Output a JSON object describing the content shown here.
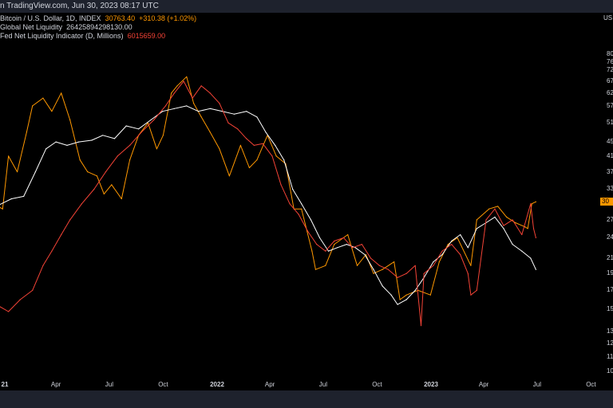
{
  "header": {
    "published": "n TradingView.com, Jun 30, 2023 08:17 UTC"
  },
  "legend": {
    "btc_name": "Bitcoin / U.S. Dollar, 1D, INDEX",
    "btc_value": "30763.40",
    "btc_change": "+310.38 (+1.02%)",
    "gnl_name": "Global Net Liquidity",
    "gnl_value": "26425894298130.00",
    "fed_name": "Fed Net Liquidity Indicator (D, Millions)",
    "fed_value": "6015659.00"
  },
  "price_axis": {
    "currency_label": "US",
    "badge": "30"
  },
  "colors": {
    "btc": "#ff9800",
    "global_net_liquidity": "#ffffff",
    "fed_net_liquidity": "#f44336",
    "background": "#000000",
    "panel": "#1e222d"
  },
  "chart_data": {
    "type": "line",
    "y_ticks": [
      "80",
      "76",
      "72",
      "67",
      "62",
      "57",
      "51",
      "45",
      "41",
      "37",
      "33",
      "30",
      "27",
      "24",
      "21",
      "19",
      "17",
      "15",
      "13",
      "12",
      "11",
      "10"
    ],
    "y_scale": "log",
    "x_ticks": [
      {
        "label": "21",
        "date": "2021-01-01",
        "bold": true
      },
      {
        "label": "Apr",
        "date": "2021-04-01",
        "bold": false
      },
      {
        "label": "Jul",
        "date": "2021-07-01",
        "bold": false
      },
      {
        "label": "Oct",
        "date": "2021-10-01",
        "bold": false
      },
      {
        "label": "2022",
        "date": "2022-01-01",
        "bold": true
      },
      {
        "label": "Apr",
        "date": "2022-04-01",
        "bold": false
      },
      {
        "label": "Jul",
        "date": "2022-07-01",
        "bold": false
      },
      {
        "label": "Oct",
        "date": "2022-10-01",
        "bold": false
      },
      {
        "label": "2023",
        "date": "2023-01-01",
        "bold": true
      },
      {
        "label": "Apr",
        "date": "2023-04-01",
        "bold": false
      },
      {
        "label": "Jul",
        "date": "2023-07-01",
        "bold": false
      },
      {
        "label": "Oct",
        "date": "2023-10-01",
        "bold": false
      }
    ],
    "series": [
      {
        "name": "Bitcoin / U.S. Dollar, 1D, INDEX",
        "color": "#ff9800",
        "points": [
          [
            "2020-11-30",
            27
          ],
          [
            "2020-12-15",
            30
          ],
          [
            "2020-12-31",
            29
          ],
          [
            "2021-01-10",
            41
          ],
          [
            "2021-01-25",
            37
          ],
          [
            "2021-02-10",
            48
          ],
          [
            "2021-02-20",
            57
          ],
          [
            "2021-03-10",
            60
          ],
          [
            "2021-03-25",
            55
          ],
          [
            "2021-04-10",
            62
          ],
          [
            "2021-04-25",
            52
          ],
          [
            "2021-05-12",
            40
          ],
          [
            "2021-05-25",
            37
          ],
          [
            "2021-06-10",
            36
          ],
          [
            "2021-06-22",
            32
          ],
          [
            "2021-07-05",
            34
          ],
          [
            "2021-07-22",
            31
          ],
          [
            "2021-08-05",
            40
          ],
          [
            "2021-08-20",
            47
          ],
          [
            "2021-09-05",
            51
          ],
          [
            "2021-09-20",
            43
          ],
          [
            "2021-10-01",
            47
          ],
          [
            "2021-10-15",
            62
          ],
          [
            "2021-10-25",
            65
          ],
          [
            "2021-11-10",
            69
          ],
          [
            "2021-11-22",
            58
          ],
          [
            "2021-12-05",
            53
          ],
          [
            "2021-12-20",
            48
          ],
          [
            "2022-01-05",
            43
          ],
          [
            "2022-01-22",
            36
          ],
          [
            "2022-02-10",
            44
          ],
          [
            "2022-02-25",
            38
          ],
          [
            "2022-03-10",
            40
          ],
          [
            "2022-03-28",
            47
          ],
          [
            "2022-04-12",
            41
          ],
          [
            "2022-04-28",
            39
          ],
          [
            "2022-05-12",
            29
          ],
          [
            "2022-05-25",
            29
          ],
          [
            "2022-06-12",
            22
          ],
          [
            "2022-06-18",
            19.5
          ],
          [
            "2022-07-05",
            20
          ],
          [
            "2022-07-20",
            23
          ],
          [
            "2022-08-12",
            24.5
          ],
          [
            "2022-08-28",
            20
          ],
          [
            "2022-09-12",
            21.5
          ],
          [
            "2022-09-25",
            19
          ],
          [
            "2022-10-10",
            19.5
          ],
          [
            "2022-10-30",
            20.5
          ],
          [
            "2022-11-09",
            16
          ],
          [
            "2022-11-20",
            16.5
          ],
          [
            "2022-12-10",
            17
          ],
          [
            "2022-12-31",
            16.5
          ],
          [
            "2023-01-15",
            20.5
          ],
          [
            "2023-01-30",
            23
          ],
          [
            "2023-02-15",
            24
          ],
          [
            "2023-03-10",
            20
          ],
          [
            "2023-03-20",
            27
          ],
          [
            "2023-04-10",
            29
          ],
          [
            "2023-04-25",
            29.5
          ],
          [
            "2023-05-10",
            27.5
          ],
          [
            "2023-05-25",
            26.5
          ],
          [
            "2023-06-10",
            25.8
          ],
          [
            "2023-06-15",
            25.5
          ],
          [
            "2023-06-22",
            30
          ],
          [
            "2023-06-29",
            30.4
          ]
        ]
      },
      {
        "name": "Global Net Liquidity",
        "color": "#ffffff",
        "points": [
          [
            "2020-11-30",
            28.5
          ],
          [
            "2020-12-20",
            29.5
          ],
          [
            "2021-01-15",
            31
          ],
          [
            "2021-02-05",
            31.5
          ],
          [
            "2021-02-25",
            37
          ],
          [
            "2021-03-15",
            43
          ],
          [
            "2021-04-01",
            45
          ],
          [
            "2021-04-20",
            44
          ],
          [
            "2021-05-10",
            45
          ],
          [
            "2021-06-01",
            45.5
          ],
          [
            "2021-06-20",
            47
          ],
          [
            "2021-07-10",
            46
          ],
          [
            "2021-07-30",
            50
          ],
          [
            "2021-08-20",
            49
          ],
          [
            "2021-09-10",
            52
          ],
          [
            "2021-09-30",
            55
          ],
          [
            "2021-10-20",
            56
          ],
          [
            "2021-11-10",
            57
          ],
          [
            "2021-11-30",
            55
          ],
          [
            "2021-12-20",
            56
          ],
          [
            "2022-01-10",
            55
          ],
          [
            "2022-01-30",
            54
          ],
          [
            "2022-02-20",
            55
          ],
          [
            "2022-03-10",
            53
          ],
          [
            "2022-03-25",
            48
          ],
          [
            "2022-04-10",
            44
          ],
          [
            "2022-04-25",
            40
          ],
          [
            "2022-05-10",
            33
          ],
          [
            "2022-05-25",
            30
          ],
          [
            "2022-06-10",
            27
          ],
          [
            "2022-06-25",
            24
          ],
          [
            "2022-07-10",
            22
          ],
          [
            "2022-07-25",
            22.5
          ],
          [
            "2022-08-10",
            23
          ],
          [
            "2022-08-25",
            22.5
          ],
          [
            "2022-09-10",
            21.5
          ],
          [
            "2022-09-25",
            19.5
          ],
          [
            "2022-10-10",
            17.5
          ],
          [
            "2022-10-25",
            16.5
          ],
          [
            "2022-11-05",
            15.5
          ],
          [
            "2022-11-20",
            16
          ],
          [
            "2022-12-05",
            17
          ],
          [
            "2022-12-20",
            18.5
          ],
          [
            "2023-01-05",
            20.5
          ],
          [
            "2023-01-20",
            21.5
          ],
          [
            "2023-02-05",
            23.5
          ],
          [
            "2023-02-20",
            24.5
          ],
          [
            "2023-03-05",
            22.5
          ],
          [
            "2023-03-20",
            25.5
          ],
          [
            "2023-04-05",
            26.5
          ],
          [
            "2023-04-20",
            27.5
          ],
          [
            "2023-05-05",
            25.5
          ],
          [
            "2023-05-20",
            23
          ],
          [
            "2023-06-05",
            22
          ],
          [
            "2023-06-20",
            21
          ],
          [
            "2023-06-29",
            19.5
          ]
        ]
      },
      {
        "name": "Fed Net Liquidity Indicator (D, Millions)",
        "color": "#f44336",
        "points": [
          [
            "2020-11-30",
            19.5
          ],
          [
            "2020-12-20",
            15.5
          ],
          [
            "2021-01-10",
            14.8
          ],
          [
            "2021-01-30",
            16
          ],
          [
            "2021-02-20",
            17
          ],
          [
            "2021-03-10",
            20
          ],
          [
            "2021-03-25",
            22
          ],
          [
            "2021-04-10",
            24.5
          ],
          [
            "2021-04-25",
            27
          ],
          [
            "2021-05-15",
            30
          ],
          [
            "2021-06-05",
            33
          ],
          [
            "2021-06-25",
            37
          ],
          [
            "2021-07-15",
            41
          ],
          [
            "2021-08-05",
            44
          ],
          [
            "2021-08-25",
            48
          ],
          [
            "2021-09-15",
            52
          ],
          [
            "2021-10-05",
            57
          ],
          [
            "2021-10-20",
            62
          ],
          [
            "2021-11-05",
            67
          ],
          [
            "2021-11-20",
            60
          ],
          [
            "2021-12-05",
            65
          ],
          [
            "2021-12-20",
            62
          ],
          [
            "2022-01-05",
            58
          ],
          [
            "2022-01-20",
            51
          ],
          [
            "2022-02-05",
            49
          ],
          [
            "2022-02-20",
            46
          ],
          [
            "2022-03-05",
            44
          ],
          [
            "2022-03-20",
            44.5
          ],
          [
            "2022-04-05",
            41
          ],
          [
            "2022-04-20",
            34
          ],
          [
            "2022-05-05",
            30
          ],
          [
            "2022-05-20",
            28
          ],
          [
            "2022-06-05",
            25
          ],
          [
            "2022-06-20",
            23
          ],
          [
            "2022-07-05",
            22
          ],
          [
            "2022-07-20",
            23.5
          ],
          [
            "2022-08-05",
            24
          ],
          [
            "2022-08-20",
            22.5
          ],
          [
            "2022-09-05",
            23
          ],
          [
            "2022-09-20",
            21
          ],
          [
            "2022-10-05",
            20
          ],
          [
            "2022-10-20",
            19.5
          ],
          [
            "2022-11-05",
            18.5
          ],
          [
            "2022-11-20",
            19
          ],
          [
            "2022-12-05",
            20
          ],
          [
            "2022-12-15",
            13.5
          ],
          [
            "2022-12-20",
            19
          ],
          [
            "2023-01-05",
            20
          ],
          [
            "2023-01-20",
            22
          ],
          [
            "2023-02-05",
            23
          ],
          [
            "2023-02-20",
            21.5
          ],
          [
            "2023-03-05",
            19
          ],
          [
            "2023-03-10",
            16.5
          ],
          [
            "2023-03-20",
            17
          ],
          [
            "2023-04-05",
            27
          ],
          [
            "2023-04-20",
            29
          ],
          [
            "2023-05-05",
            26
          ],
          [
            "2023-05-20",
            27
          ],
          [
            "2023-06-05",
            24.5
          ],
          [
            "2023-06-20",
            30
          ],
          [
            "2023-06-25",
            25.5
          ],
          [
            "2023-06-29",
            24
          ]
        ]
      }
    ]
  }
}
